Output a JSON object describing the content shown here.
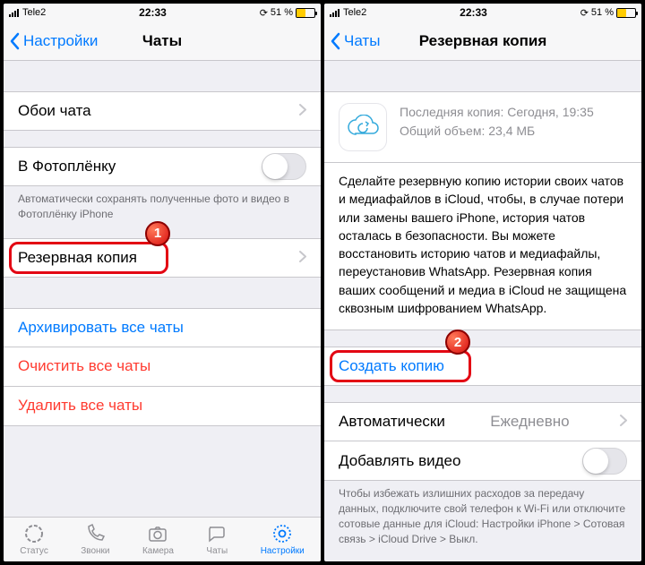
{
  "status": {
    "carrier": "Tele2",
    "time": "22:33",
    "battery": "51 %",
    "spinner": "⟳"
  },
  "left": {
    "back": "Настройки",
    "title": "Чаты",
    "wallpaper": "Обои чата",
    "camera_roll": "В Фотоплёнку",
    "camera_roll_note": "Автоматически сохранять полученные фото и видео в Фотоплёнку iPhone",
    "backup": "Резервная копия",
    "archive": "Архивировать все чаты",
    "clear": "Очистить все чаты",
    "delete": "Удалить все чаты",
    "tabs": {
      "status": "Статус",
      "calls": "Звонки",
      "camera": "Камера",
      "chats": "Чаты",
      "settings": "Настройки"
    }
  },
  "right": {
    "back": "Чаты",
    "title": "Резервная копия",
    "last_label": "Последняя копия:",
    "last_value": "Сегодня, 19:35",
    "size_label": "Общий объем:",
    "size_value": "23,4 МБ",
    "description": "Сделайте резервную копию истории своих чатов и медиафайлов в iCloud, чтобы, в случае потери или замены вашего iPhone, история чатов осталась в безопасности. Вы можете восстановить историю чатов и медиафайлы, переустановив WhatsApp. Резервная копия ваших сообщений и медиа в iCloud не защищена сквозным шифрованием WhatsApp.",
    "create": "Создать копию",
    "auto_label": "Автоматически",
    "auto_value": "Ежедневно",
    "video": "Добавлять видео",
    "note": "Чтобы избежать излишних расходов за передачу данных, подключите свой телефон к Wi-Fi или отключите сотовые данные для iCloud: Настройки iPhone > Сотовая связь > iCloud Drive > Выкл."
  },
  "badges": {
    "one": "1",
    "two": "2"
  }
}
